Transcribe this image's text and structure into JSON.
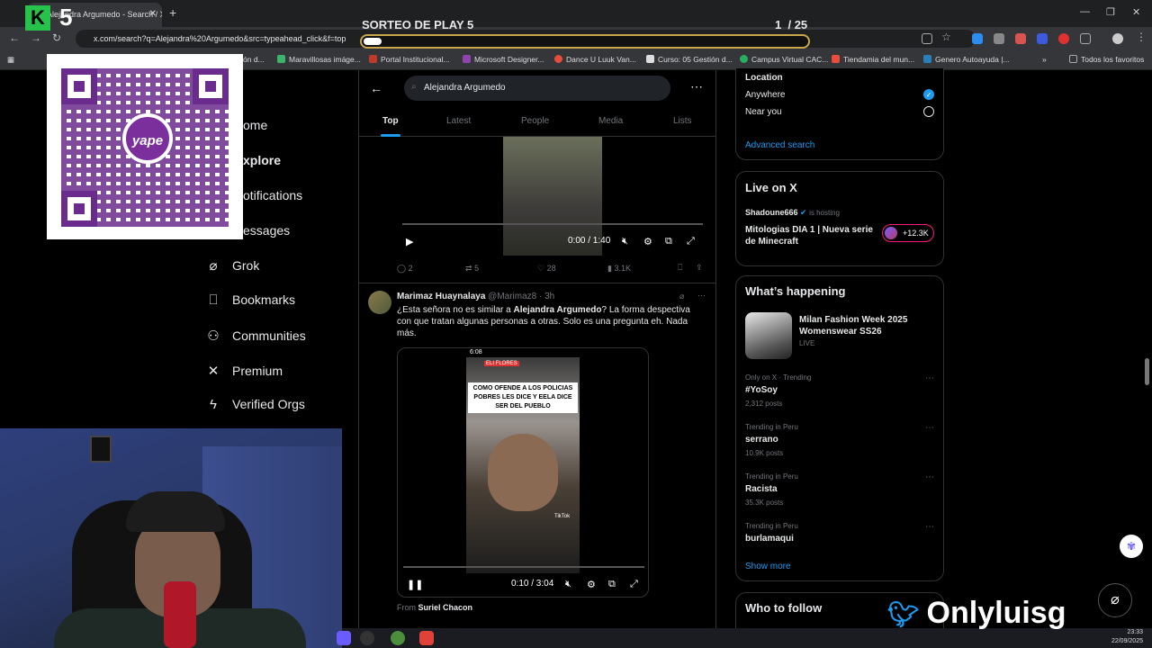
{
  "browser": {
    "tab_title": "Alejandra Argumedo - Search / X",
    "url": "x.com/search?q=Alejandra%20Argumedo&src=typeahead_click&f=top",
    "bookmarks": [
      "ón d...",
      "Maravillosas imáge...",
      "Portal Institucional...",
      "Microsoft Designer...",
      "Dance U Luuk Van...",
      "Curso: 05 Gestión d...",
      "Campus Virtual CAC...",
      "Tiendamia del mun...",
      "Genero Autoayuda |..."
    ],
    "bookmarks_all": "Todos los favoritos"
  },
  "overlay": {
    "logo_letter": "K",
    "logo_number": "5",
    "title": "SORTEO DE PLAY 5",
    "counter_current": "1",
    "counter_total": "/ 25",
    "progress": 0.04,
    "yape_label": "yape",
    "yape_symbol": "S/",
    "brand_name": "Onlyluisg"
  },
  "leftnav": {
    "partial_items": [
      "ome",
      "xplore",
      "otifications",
      "essages"
    ],
    "items": [
      {
        "icon": "grok-icon",
        "glyph": "⌀",
        "label": "Grok"
      },
      {
        "icon": "bookmark-icon",
        "glyph": "⎕",
        "label": "Bookmarks"
      },
      {
        "icon": "communities-icon",
        "glyph": "⚇",
        "label": "Communities"
      },
      {
        "icon": "x-logo-icon",
        "glyph": "𝕏",
        "label": "Premium"
      },
      {
        "icon": "lightning-icon",
        "glyph": "ϟ",
        "label": "Verified Orgs"
      }
    ]
  },
  "search": {
    "query": "Alejandra Argumedo",
    "tabs": [
      "Top",
      "Latest",
      "People",
      "Media",
      "Lists"
    ],
    "active_tab": "Top"
  },
  "tweet1": {
    "video_time": "0:00 / 1:40",
    "replies": "2",
    "retweets": "5",
    "likes": "28",
    "views": "3.1K"
  },
  "tweet2": {
    "name": "Marimaz Huaynalaya",
    "handle": "@Marimaz8 · 3h",
    "text_pre": "¿Esta señora no es similar a ",
    "text_bold": "Alejandra Argumedo",
    "text_post": "? La forma despectiva con que tratan algunas personas a otras. Solo es una pregunta eh. Nada más.",
    "video_caption": "COMO OFENDE A LOS POLICIAS POBRES LES DICE Y EELA DICE SER DEL PUEBLO",
    "video_top_time": "6:08",
    "video_top_name": "ELI FLORES",
    "video_watermark": "TikTok",
    "video_time": "0:10 / 3:04",
    "from_label": "From",
    "from_name": "Suriel Chacon"
  },
  "right": {
    "location_title": "Location",
    "anywhere": "Anywhere",
    "near_you": "Near you",
    "advanced_search": "Advanced search",
    "live_title": "Live on X",
    "live_host": "Shadoune666",
    "live_hosting": "is hosting",
    "live_stream": "Mitologias DIA 1 | Nueva serie de Minecraft",
    "live_count": "+12.3K",
    "happening_title": "What’s happening",
    "event_title": "Milan Fashion Week 2025 Womenswear SS26",
    "event_status": "LIVE",
    "trends": [
      {
        "context": "Only on X · Trending",
        "name": "#YoSoy",
        "posts": "2,312 posts"
      },
      {
        "context": "Trending in Peru",
        "name": "serrano",
        "posts": "10.9K posts"
      },
      {
        "context": "Trending in Peru",
        "name": "Racista",
        "posts": "35.3K posts"
      },
      {
        "context": "Trending in Peru",
        "name": "burlamaqui",
        "posts": ""
      }
    ],
    "show_more": "Show more",
    "who_to_follow": "Who to follow"
  },
  "taskbar": {
    "time": "23:33",
    "date": "22/09/2025"
  },
  "colors": {
    "accent": "#1d9bf0",
    "background": "#000000",
    "border": "#2f3336",
    "muted": "#71767b",
    "yape": "#6a2c8c",
    "overlay_gold": "#c9a64a"
  }
}
